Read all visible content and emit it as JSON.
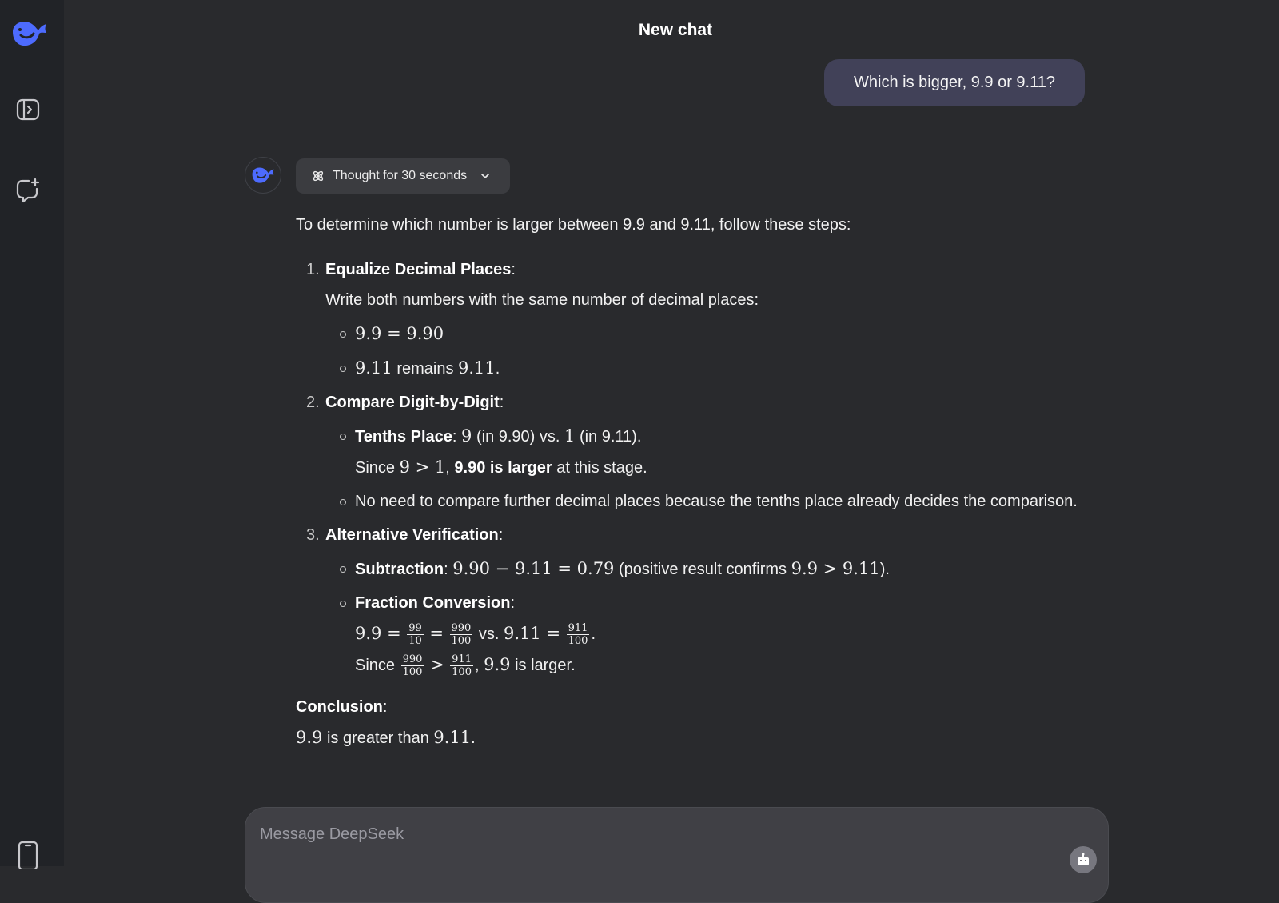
{
  "app": {
    "title": "New chat"
  },
  "sidebar": {
    "logo_icon": "deepseek-whale-logo",
    "toggle_icon": "sidebar-toggle-icon",
    "new_chat_icon": "new-chat-icon",
    "mobile_icon": "mobile-phone-icon"
  },
  "user_message": {
    "text": "Which is bigger, 9.9 or 9.11?"
  },
  "assistant": {
    "thought_label": "Thought for 30 seconds",
    "intro": "To determine which number is larger between 9.9 and 9.11, follow these steps:",
    "steps": [
      {
        "number": "1.",
        "title": "Equalize Decimal Places",
        "colon": ":",
        "desc": "Write both numbers with the same number of decimal places:",
        "items": [
          {
            "math": "9.9 = 9.90"
          },
          {
            "math_a": "9.11",
            "text": " remains ",
            "math_b": "9.11",
            "end": "."
          }
        ]
      },
      {
        "number": "2.",
        "title": "Compare Digit-by-Digit",
        "colon": ":",
        "items": [
          {
            "label": "Tenths Place",
            "colon": ":",
            "m1": "9",
            "t1": " (in 9.90) vs. ",
            "m2": "1",
            "t2": " (in 9.11).",
            "line2_pre": "Since ",
            "line2_math": "9 > 1",
            "line2_comma": ", ",
            "line2_bold": "9.90 is larger",
            "line2_post": " at this stage."
          },
          {
            "text": "No need to compare further decimal places because the tenths place already decides the comparison."
          }
        ]
      },
      {
        "number": "3.",
        "title": "Alternative Verification",
        "colon": ":",
        "items": [
          {
            "label": "Subtraction",
            "colon": ": ",
            "math": "9.90 − 9.11 = 0.79",
            "text": " (positive result confirms ",
            "math2": "9.9 > 9.11",
            "end": ")."
          },
          {
            "label": "Fraction Conversion",
            "colon": ":",
            "l1_m1": "9.9 =",
            "f1_num": "99",
            "f1_den": "10",
            "eq": "=",
            "f2_num": "990",
            "f2_den": "100",
            "vs": " vs. ",
            "l1_m2": "9.11 =",
            "f3_num": "911",
            "f3_den": "100",
            "l1_end": ".",
            "l2_pre": "Since ",
            "f4_num": "990",
            "f4_den": "100",
            "gt": ">",
            "f5_num": "911",
            "f5_den": "100",
            "l2_comma": ", ",
            "l2_math": "9.9",
            "l2_post": " is larger."
          }
        ]
      }
    ],
    "conclusion_label": "Conclusion",
    "conclusion_colon": ":",
    "conclusion_m1": "9.9",
    "conclusion_text": " is greater than ",
    "conclusion_m2": "9.11",
    "conclusion_end": "."
  },
  "composer": {
    "placeholder": "Message DeepSeek",
    "send_icon": "robot-icon"
  },
  "colors": {
    "background": "#292a2d",
    "sidebar": "#212327",
    "user_bubble": "#414158",
    "accent": "#4d6bfe"
  }
}
